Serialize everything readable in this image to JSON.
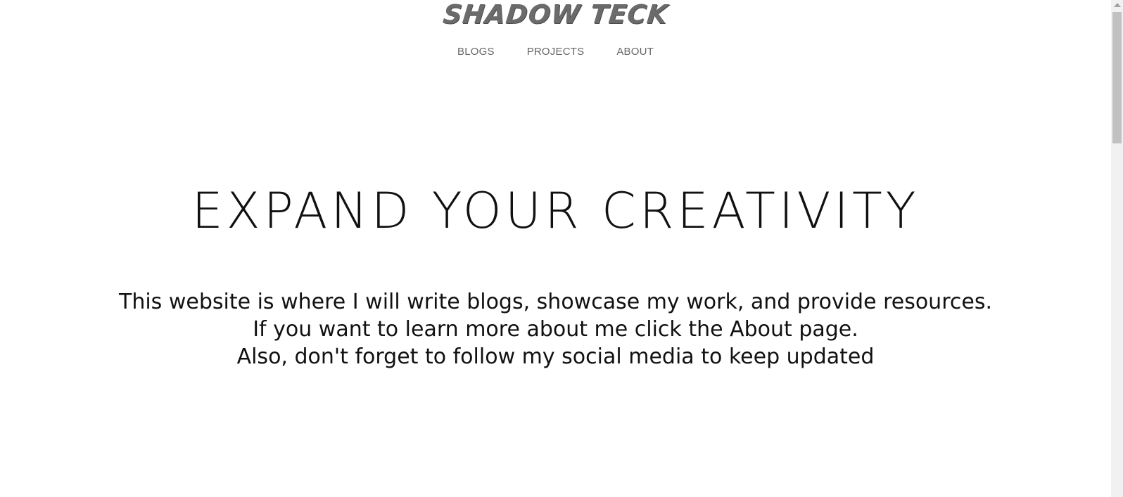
{
  "header": {
    "logo_text": "SHADOW TECK",
    "nav": [
      {
        "label": "BLOGS"
      },
      {
        "label": "PROJECTS"
      },
      {
        "label": "ABOUT"
      }
    ]
  },
  "hero": {
    "title": "EXPAND YOUR CREATIVITY",
    "description_lines": [
      "This website is where I will write blogs, showcase my work, and provide resources.",
      "If you want to learn more about me click the About page.",
      "Also, don't forget to follow my social media to keep updated"
    ]
  },
  "colors": {
    "logo": "#6b6b6b",
    "nav": "#666666",
    "text": "#111111",
    "background": "#ffffff",
    "scrollbar_track": "#f1f1f1",
    "scrollbar_thumb": "#c1c1c1"
  },
  "icons": {
    "scroll_up": "scroll-up-arrow-icon"
  }
}
